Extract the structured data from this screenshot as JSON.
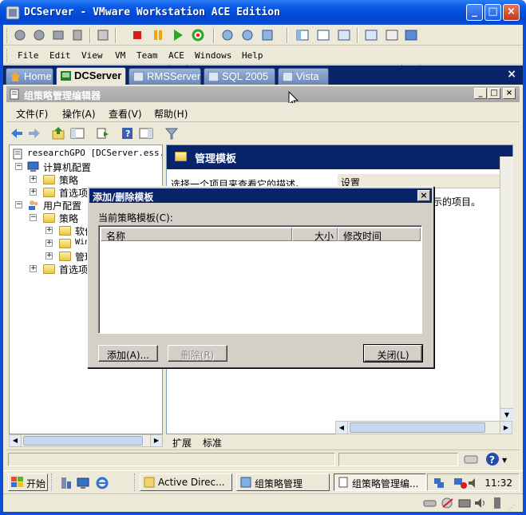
{
  "vm_window": {
    "title": "DCServer - VMware Workstation ACE Edition",
    "controls": [
      "_",
      "□",
      "×"
    ]
  },
  "vm_menu": [
    "File",
    "Edit",
    "View",
    "VM",
    "Team",
    "ACE",
    "Windows",
    "Help"
  ],
  "vm_tabs": [
    {
      "label": "Home",
      "active": false
    },
    {
      "label": "DCServer",
      "active": true
    },
    {
      "label": "RMSServer",
      "active": false
    },
    {
      "label": "SQL 2005",
      "active": false
    },
    {
      "label": "Vista",
      "active": false
    }
  ],
  "tabs_close": "×",
  "gp_window": {
    "title": "组策略管理编辑器",
    "controls": [
      "_",
      "□",
      "×"
    ]
  },
  "gp_menu": [
    "文件(F)",
    "操作(A)",
    "查看(V)",
    "帮助(H)"
  ],
  "tree": {
    "root": "researchGPO [DCServer.ess.co",
    "computer_config": "计算机配置",
    "cc_policy": "策略",
    "cc_prefs": "首选项",
    "user_config": "用户配置",
    "uc_policy": "策略",
    "uc_software": "软件",
    "uc_windows": "Win",
    "uc_admin": "管理",
    "uc_prefs": "首选项"
  },
  "right_pane": {
    "header": "管理模板",
    "description": "选择一个项目来查看它的描述。",
    "column_settings": "设置",
    "item_hint": "示的项目。"
  },
  "bottom_tabs": [
    "扩展",
    "标准"
  ],
  "dialog": {
    "title": "添加/删除模板",
    "close": "×",
    "label": "当前策略模板(C):",
    "columns": [
      "名称",
      "大小",
      "修改时间"
    ],
    "buttons": {
      "add": "添加(A)...",
      "remove": "删除(R)",
      "close": "关闭(L)"
    }
  },
  "taskbar": {
    "start": "开始",
    "tasks": [
      {
        "label": "Active Direc...",
        "active": false
      },
      {
        "label": "组策略管理",
        "active": false
      },
      {
        "label": "组策略管理编...",
        "active": true
      }
    ],
    "clock": "11:32"
  },
  "colors": {
    "xp_title_blue": "#0a58e6",
    "selection_navy": "#0a246a",
    "dialog_gray": "#d4d0c8",
    "xp_face": "#ece9d8"
  }
}
